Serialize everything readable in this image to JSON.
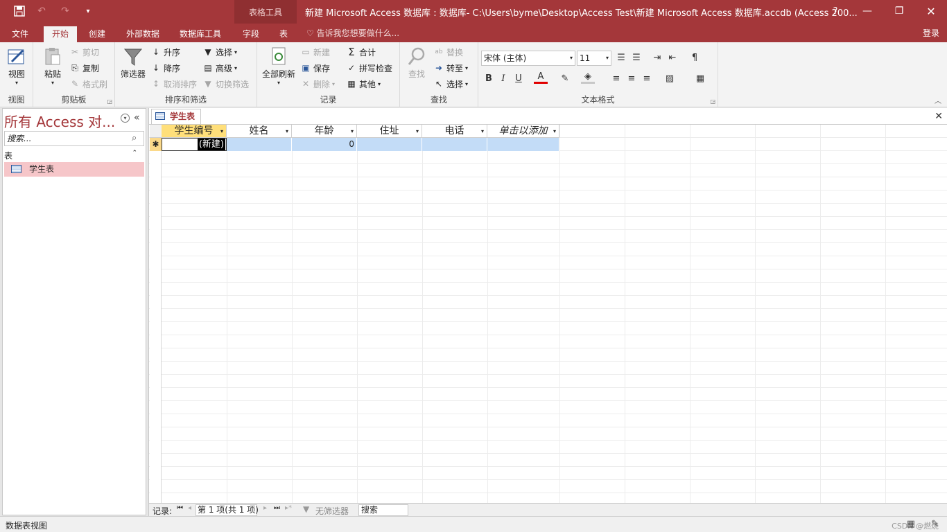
{
  "titlebar": {
    "context_tools": "表格工具",
    "window_title": "新建 Microsoft Access 数据库 : 数据库- C:\\Users\\byme\\Desktop\\Access Test\\新建 Microsoft Access 数据库.accdb (Access 200...",
    "help": "?",
    "accent": "#a4373a"
  },
  "tabs": [
    "文件",
    "开始",
    "创建",
    "外部数据",
    "数据库工具",
    "字段",
    "表"
  ],
  "tell_me": "告诉我您想要做什么...",
  "login": "登录",
  "ribbon": {
    "view": {
      "btn": "视图",
      "label": "视图"
    },
    "clipboard": {
      "paste": "粘贴",
      "cut": "剪切",
      "copy": "复制",
      "format_painter": "格式刷",
      "label": "剪贴板"
    },
    "sort": {
      "filter": "筛选器",
      "asc": "升序",
      "desc": "降序",
      "clear": "取消排序",
      "selection": "选择",
      "advanced": "高级",
      "toggle": "切换筛选",
      "label": "排序和筛选"
    },
    "records": {
      "refresh": "全部刷新",
      "new": "新建",
      "save": "保存",
      "delete": "删除",
      "totals": "合计",
      "spelling": "拼写检查",
      "more": "其他",
      "label": "记录"
    },
    "find": {
      "find": "查找",
      "replace": "替换",
      "goto": "转至",
      "select": "选择",
      "label": "查找"
    },
    "text": {
      "font": "宋体 (主体)",
      "size": "11",
      "label": "文本格式",
      "bold": "B",
      "italic": "I",
      "underline": "U"
    }
  },
  "nav": {
    "title": "所有 Access 对...",
    "search_placeholder": "搜索...",
    "category": "表",
    "item": "学生表"
  },
  "document": {
    "tab": "学生表",
    "columns": [
      "学生编号",
      "姓名",
      "年龄",
      "住址",
      "电话",
      "单击以添加"
    ],
    "new_row": {
      "id": "(新建)",
      "age": "0"
    }
  },
  "recnav": {
    "label": "记录:",
    "current": "第 1 项(共 1 项)",
    "filter": "无筛选器",
    "search": "搜索"
  },
  "status": {
    "view": "数据表视图",
    "watermark": "CSDN @燃烧"
  }
}
